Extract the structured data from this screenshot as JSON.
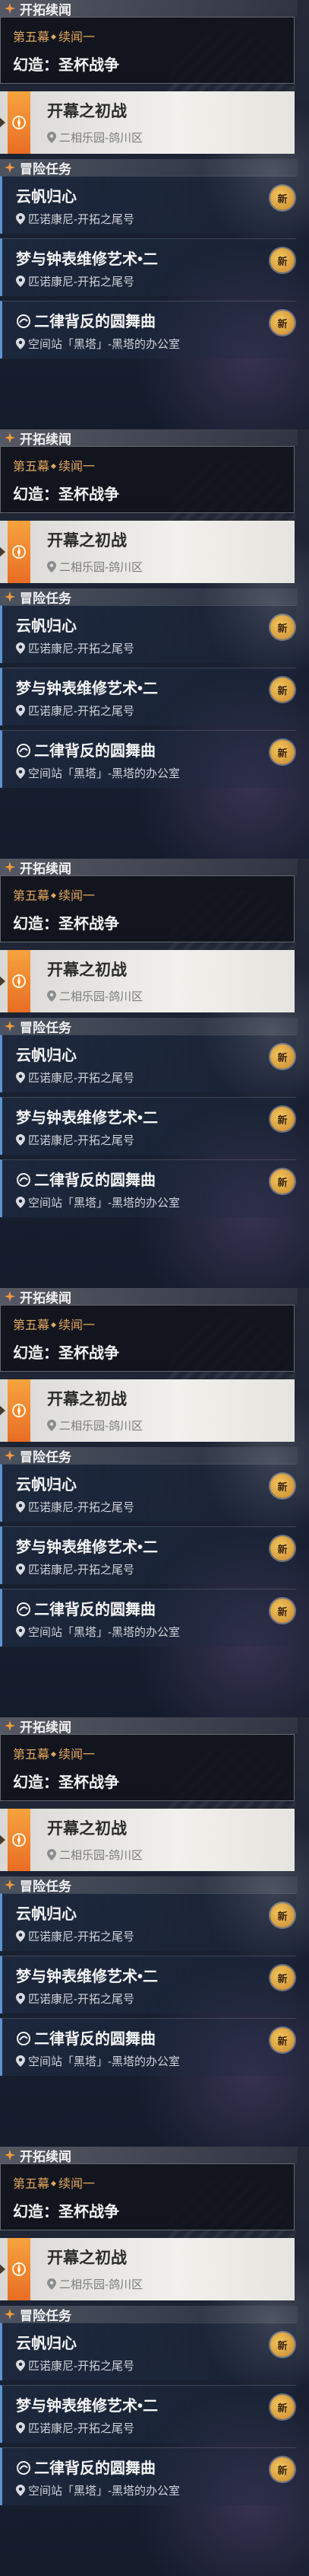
{
  "sections": {
    "continue_header": "开拓续闻",
    "adventure_header": "冒险任务",
    "header_icon": "star-compass-icon"
  },
  "trailblaze": {
    "chapter_part1": "第五幕",
    "chapter_part2": "续闻一",
    "title": "幻造：圣杯战争"
  },
  "active_mission": {
    "title": "开幕之初战",
    "location": "二相乐园-鸽川区",
    "badge_icon": "trailblaze-mission-icon",
    "accent": "#f08a2f"
  },
  "adventure_missions": [
    {
      "title": "云帆归心",
      "location": "匹诺康尼-开拓之尾号",
      "badge": "新"
    },
    {
      "title": "梦与钟表维修艺术•二",
      "location": "匹诺康尼-开拓之尾号",
      "badge": "新"
    },
    {
      "title": "二律背反的圆舞曲",
      "location": "空间站「黑塔」-黑塔的办公室",
      "badge": "新",
      "special_icon": "mission-swirl-icon"
    }
  ],
  "colors": {
    "chapter_gold": "#e2a75d",
    "adventure_accent": "#5b93d4",
    "new_badge": "#e6a845"
  },
  "repeat_count": 6
}
